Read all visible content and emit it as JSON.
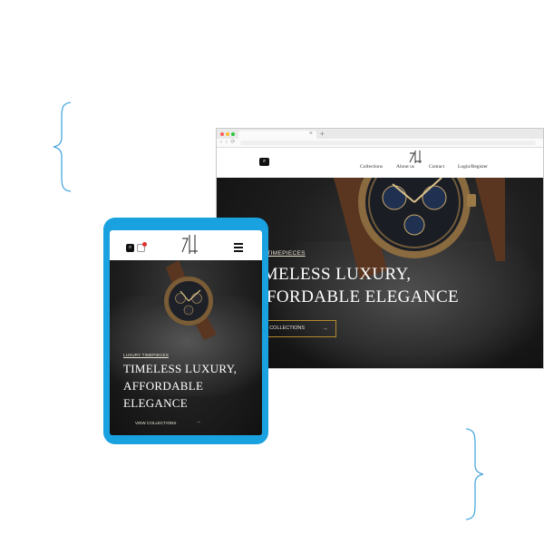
{
  "desktop": {
    "nav": {
      "collections": "Collections",
      "about": "About us",
      "contact": "Contact",
      "login": "Login/Register"
    },
    "hero": {
      "eyebrow": "RY TIMEPIECES",
      "headline_line1": "IMELESS LUXURY,",
      "headline_line2": "FFORDABLE ELEGANCE",
      "cta_label": "V COLLECTIONS",
      "cta_arrow": "→"
    },
    "tab": {
      "close": "×",
      "new_tab": "+"
    }
  },
  "tablet": {
    "hero": {
      "eyebrow": "LUXURY TIMEPIECES",
      "headline_line1": "TIMELESS LUXURY,",
      "headline_line2": "AFFORDABLE",
      "headline_line3": "ELEGANCE",
      "cta_label": "VIEW COLLECTIONS",
      "cta_arrow": "→"
    }
  },
  "icons": {
    "search": "search-icon",
    "cart": "cart-icon",
    "menu": "hamburger-menu-icon",
    "logo": "brand-logo"
  },
  "colors": {
    "tablet_frame": "#1aa2e0",
    "cta_border": "#b48a2a",
    "brace": "#4aa8de"
  }
}
